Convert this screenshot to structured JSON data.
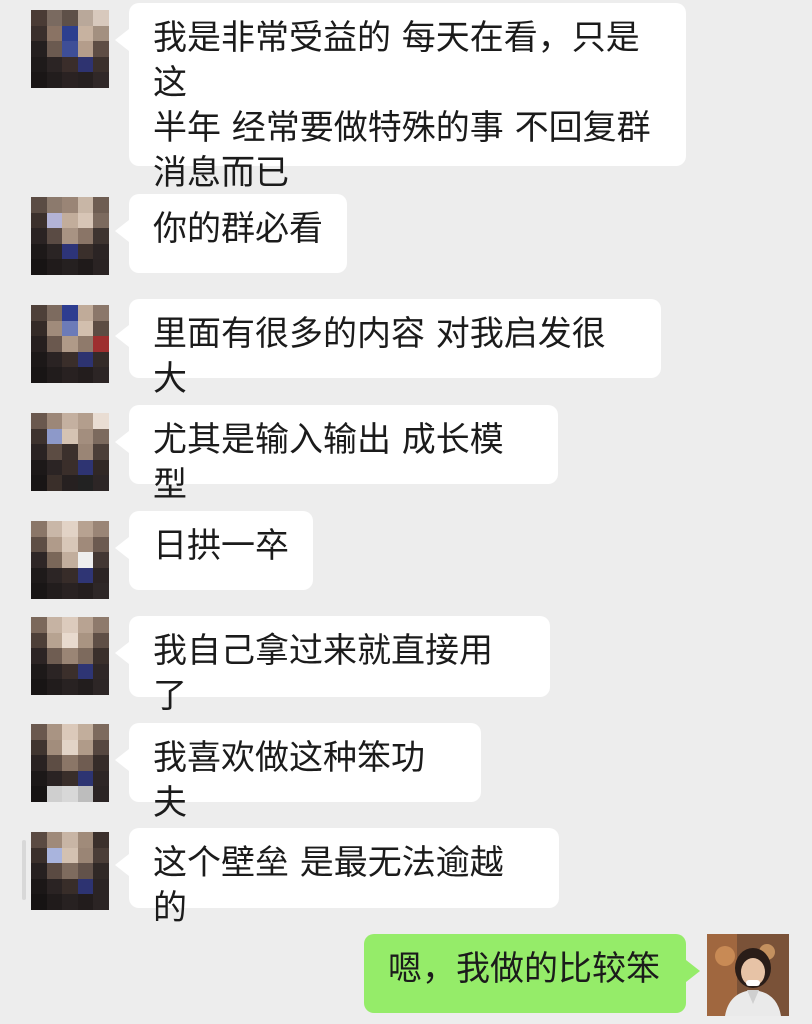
{
  "colors": {
    "background": "#ededed",
    "incoming_bubble": "#ffffff",
    "outgoing_bubble": "#95ec69",
    "text": "#1b1b1b"
  },
  "messages": [
    {
      "side": "incoming",
      "text": "我是非常受益的 每天在看，只是这\n半年 经常要做特殊的事 不回复群\n消息而已"
    },
    {
      "side": "incoming",
      "text": "你的群必看"
    },
    {
      "side": "incoming",
      "text": "里面有很多的内容 对我启发很大"
    },
    {
      "side": "incoming",
      "text": "尤其是输入输出 成长模型"
    },
    {
      "side": "incoming",
      "text": "日拱一卒"
    },
    {
      "side": "incoming",
      "text": "我自己拿过来就直接用了"
    },
    {
      "side": "incoming",
      "text": "我喜欢做这种笨功夫"
    },
    {
      "side": "incoming",
      "text": "这个壁垒 是最无法逾越的"
    },
    {
      "side": "outgoing",
      "text": "嗯，我做的比较笨"
    }
  ]
}
